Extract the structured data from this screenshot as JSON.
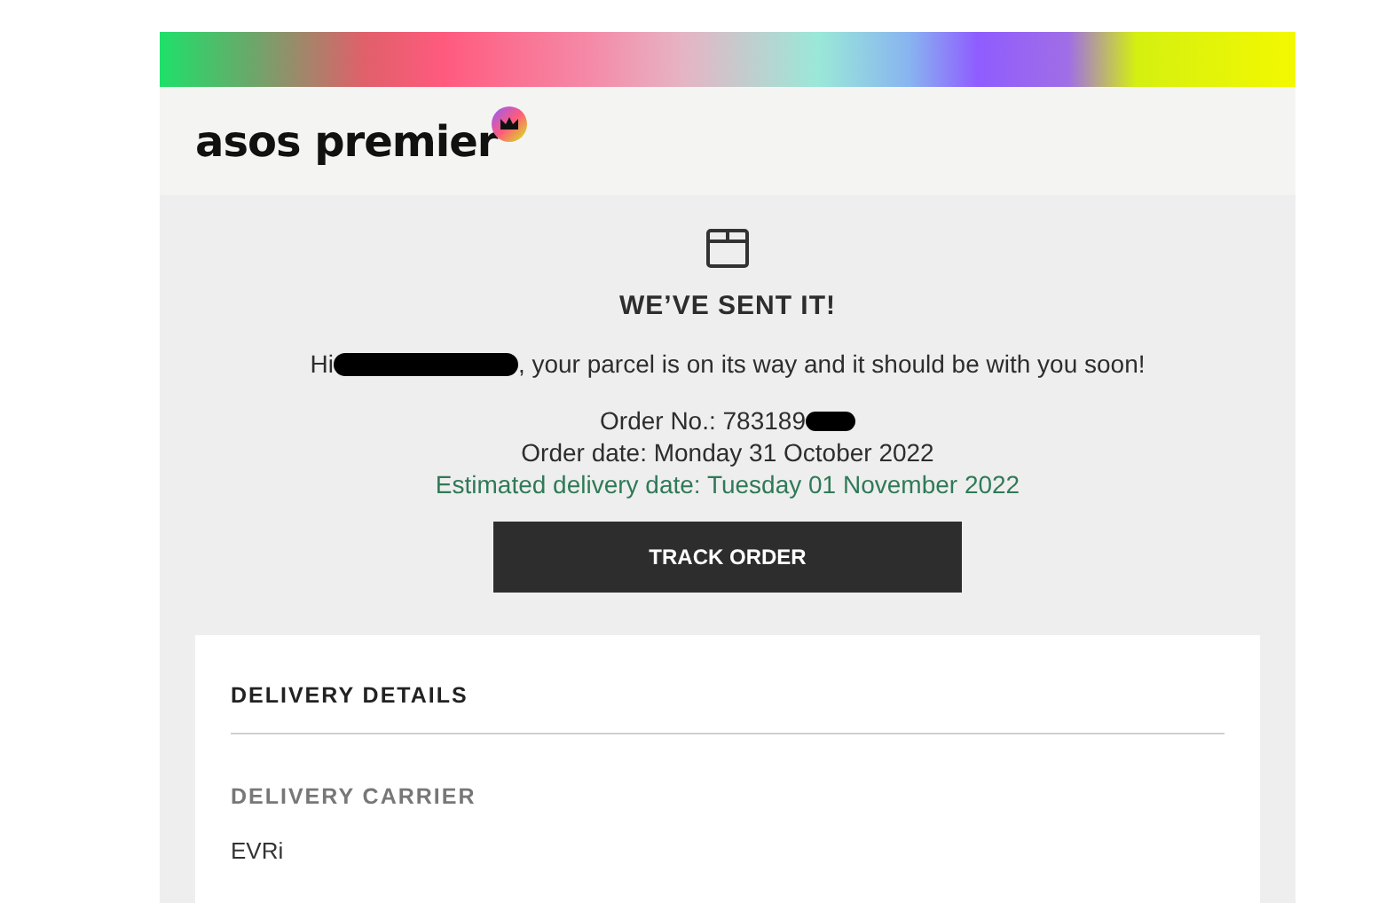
{
  "header": {
    "logo": "asos premier"
  },
  "hero": {
    "title": "WE’VE SENT IT!",
    "greeting_prefix": "Hi",
    "greeting_rest": ", your parcel is on its way and it should be with you soon!",
    "order_number": "Order No.: 783189",
    "order_date": "Order date: Monday 31 October 2022",
    "estimated_delivery": "Estimated delivery date: Tuesday 01 November 2022",
    "button": "TRACK ORDER"
  },
  "delivery_details": {
    "title": "DELIVERY DETAILS",
    "carrier_label": "DELIVERY CARRIER",
    "carrier": "EVRi"
  }
}
